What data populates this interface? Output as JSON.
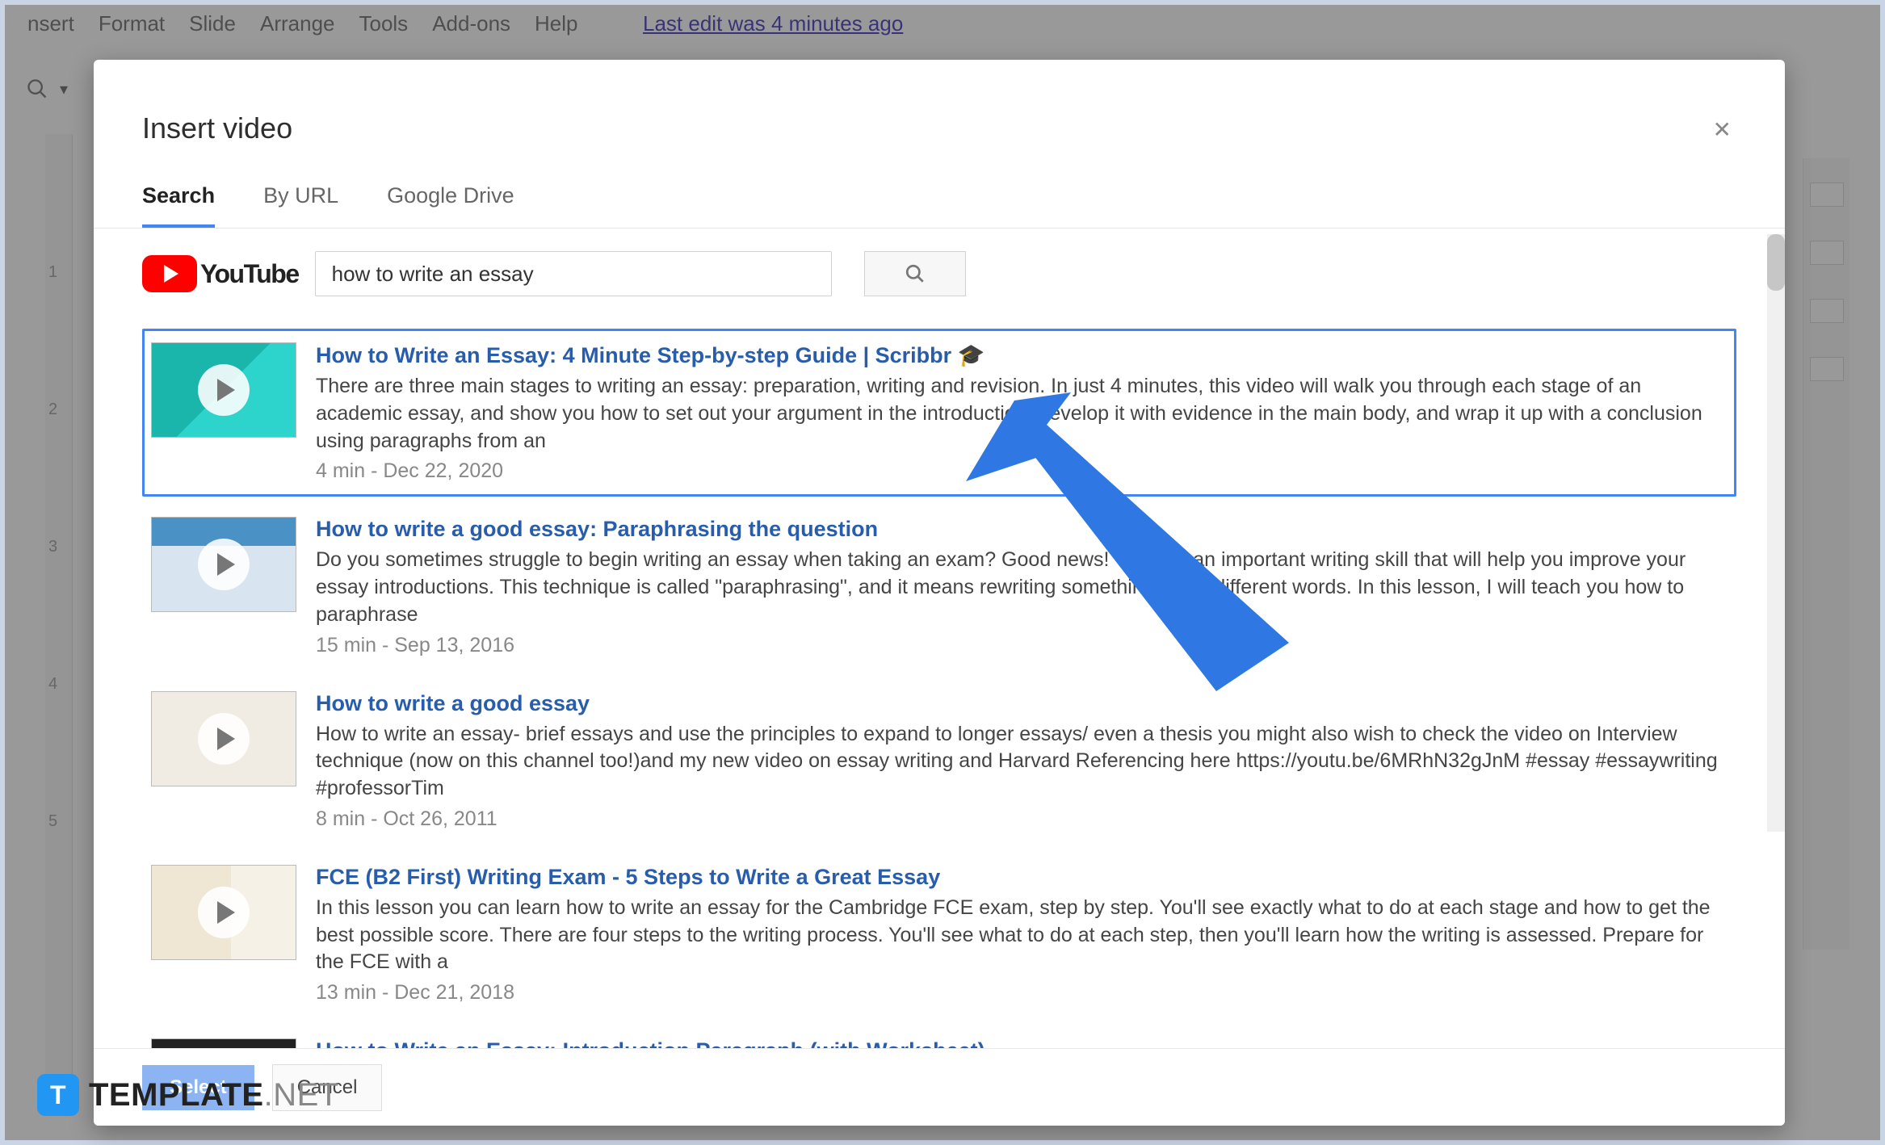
{
  "menubar": {
    "items": [
      "nsert",
      "Format",
      "Slide",
      "Arrange",
      "Tools",
      "Add-ons",
      "Help"
    ]
  },
  "last_edit": "Last edit was 4 minutes ago",
  "ruler": {
    "t1": "1",
    "t2": "2",
    "t3": "3",
    "t4": "4",
    "t5": "5"
  },
  "dialog": {
    "title": "Insert video",
    "tabs": {
      "search": "Search",
      "by_url": "By URL",
      "drive": "Google Drive"
    },
    "youtube_label": "YouTube",
    "search_value": "how to write an essay",
    "footer": {
      "select": "Select",
      "cancel": "Cancel"
    }
  },
  "results": [
    {
      "title": "How to Write an Essay: 4 Minute Step-by-step Guide | Scribbr 🎓",
      "desc": "There are three main stages to writing an essay: preparation, writing and revision. In just 4 minutes, this video will walk you through each stage of an academic essay, and show you how to set out your argument in the introduction, develop it with evidence in the main body, and wrap it up with a conclusion using paragraphs from an",
      "meta": "4 min - Dec 22, 2020"
    },
    {
      "title": "How to write a good essay: Paraphrasing the question",
      "desc": "Do you sometimes struggle to begin writing an essay when taking an exam? Good news! There is an important writing skill that will help you improve your essay introductions. This technique is called \"paraphrasing\", and it means rewriting something using different words. In this lesson, I will teach you how to paraphrase",
      "meta": "15 min - Sep 13, 2016"
    },
    {
      "title": "How to write a good essay",
      "desc": "How to write an essay- brief essays and use the principles to expand to longer essays/ even a thesis you might also wish to check the video on Interview technique (now on this channel too!)and my new video on essay writing and Harvard Referencing here https://youtu.be/6MRhN32gJnM #essay #essaywriting #professorTim",
      "meta": "8 min - Oct 26, 2011"
    },
    {
      "title": "FCE (B2 First) Writing Exam - 5 Steps to Write a Great Essay",
      "desc": "In this lesson you can learn how to write an essay for the Cambridge FCE exam, step by step. You'll see exactly what to do at each stage and how to get the best possible score. There are four steps to the writing process. You'll see what to do at each step, then you'll learn how the writing is assessed. Prepare for the FCE with a",
      "meta": "13 min - Dec 21, 2018"
    },
    {
      "title": "How to Write an Essay: Introduction Paragraph (with Worksheet)",
      "desc": "",
      "meta": ""
    }
  ],
  "watermark": {
    "brand1": "TEMPLATE",
    "brand2": ".NET"
  }
}
